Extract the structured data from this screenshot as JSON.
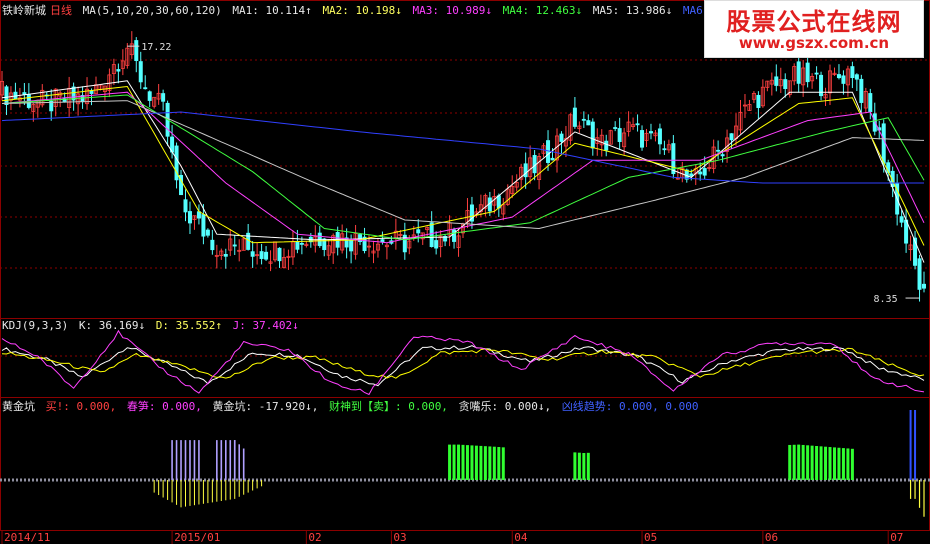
{
  "header": {
    "stock_name": "铁岭新城",
    "period": "日线",
    "ma_params": "MA(5,10,20,30,60,120)",
    "ma1": "MA1: 10.114↑",
    "ma2": "MA2: 10.198↓",
    "ma3": "MA3: 10.989↓",
    "ma4": "MA4: 12.463↓",
    "ma5": "MA5: 13.986↓",
    "ma6": "MA6: 14.551↓"
  },
  "kdj_header": {
    "name": "KDJ(9,3,3)",
    "k": "K: 36.169↓",
    "d": "D: 35.552↑",
    "j": "J: 37.402↓"
  },
  "gold_header": {
    "name": "黄金坑",
    "buy": "买!: 0.000,",
    "spring": "春笋: 0.000,",
    "gold": "黄金坑: -17.920↓,",
    "sell": "财神到【卖】: 0.000,",
    "greedy": "贪嘴乐: 0.000↓,",
    "trend": "凶线趋势: 0.000, 0.000"
  },
  "watermark": {
    "title": "股票公式在线网",
    "url": "www.gszx.com.cn"
  },
  "colors": {
    "up": "#ff4040",
    "down": "#54ffff",
    "ma1": "#ffffff",
    "ma2": "#ffff00",
    "ma3": "#ff40ff",
    "ma4": "#40ff40",
    "ma5": "#c8c8c8",
    "ma6": "#3040ff",
    "grid": "#8b0000",
    "buy_bar": "#ffff40",
    "spring": "#b0a0ff",
    "sell": "#30ff30",
    "trend": "#3050ff"
  },
  "chart_data": [
    {
      "type": "candlestick",
      "title": "铁岭新城 日线",
      "ylim": [
        8.0,
        18.0
      ],
      "annotations": [
        {
          "label": "17.22",
          "x_index": 28
        },
        {
          "label": "8.35",
          "x_index": 205
        }
      ],
      "x_ticks": [
        "2014/11",
        "2015/01",
        "02",
        "03",
        "04",
        "05",
        "06",
        "07"
      ],
      "price_points": [
        [
          0,
          15.6
        ],
        [
          10,
          15.2
        ],
        [
          20,
          15.5
        ],
        [
          28,
          17.22
        ],
        [
          32,
          15.8
        ],
        [
          36,
          14.9
        ],
        [
          40,
          11.6
        ],
        [
          48,
          10.2
        ],
        [
          60,
          10.0
        ],
        [
          70,
          10.5
        ],
        [
          80,
          10.4
        ],
        [
          90,
          10.3
        ],
        [
          100,
          10.6
        ],
        [
          110,
          11.8
        ],
        [
          120,
          13.1
        ],
        [
          128,
          14.6
        ],
        [
          134,
          13.8
        ],
        [
          140,
          14.3
        ],
        [
          148,
          13.6
        ],
        [
          154,
          12.3
        ],
        [
          160,
          13.5
        ],
        [
          168,
          15.4
        ],
        [
          176,
          16.1
        ],
        [
          184,
          15.9
        ],
        [
          190,
          16.4
        ],
        [
          196,
          14.0
        ],
        [
          202,
          10.4
        ],
        [
          206,
          8.35
        ]
      ],
      "series": [
        {
          "name": "MA1",
          "points": [
            [
              0,
              15.4
            ],
            [
              28,
              16.0
            ],
            [
              40,
              13.0
            ],
            [
              48,
              10.6
            ],
            [
              70,
              10.4
            ],
            [
              100,
              10.5
            ],
            [
              128,
              14.2
            ],
            [
              154,
              12.6
            ],
            [
              176,
              15.6
            ],
            [
              190,
              15.6
            ],
            [
              206,
              9.6
            ]
          ]
        },
        {
          "name": "MA2",
          "points": [
            [
              0,
              15.3
            ],
            [
              28,
              15.8
            ],
            [
              44,
              11.4
            ],
            [
              56,
              10.3
            ],
            [
              80,
              10.4
            ],
            [
              110,
              11.4
            ],
            [
              128,
              13.8
            ],
            [
              154,
              12.8
            ],
            [
              178,
              15.2
            ],
            [
              190,
              15.4
            ],
            [
              206,
              10.2
            ]
          ]
        },
        {
          "name": "MA3",
          "points": [
            [
              0,
              15.2
            ],
            [
              28,
              15.6
            ],
            [
              50,
              12.4
            ],
            [
              66,
              10.6
            ],
            [
              86,
              10.3
            ],
            [
              114,
              11.2
            ],
            [
              132,
              13.2
            ],
            [
              156,
              13.2
            ],
            [
              180,
              14.6
            ],
            [
              194,
              14.9
            ],
            [
              206,
              11.0
            ]
          ]
        },
        {
          "name": "MA4",
          "points": [
            [
              0,
              15.2
            ],
            [
              28,
              15.5
            ],
            [
              56,
              12.8
            ],
            [
              72,
              10.8
            ],
            [
              90,
              10.4
            ],
            [
              118,
              11.0
            ],
            [
              140,
              12.6
            ],
            [
              160,
              13.2
            ],
            [
              184,
              14.2
            ],
            [
              198,
              14.7
            ],
            [
              206,
              12.5
            ]
          ]
        },
        {
          "name": "MA5",
          "points": [
            [
              0,
              15.2
            ],
            [
              28,
              15.3
            ],
            [
              70,
              12.4
            ],
            [
              90,
              11.1
            ],
            [
              120,
              10.8
            ],
            [
              146,
              11.8
            ],
            [
              166,
              12.6
            ],
            [
              190,
              14.0
            ],
            [
              206,
              13.9
            ]
          ]
        },
        {
          "name": "MA6",
          "points": [
            [
              0,
              14.6
            ],
            [
              40,
              14.9
            ],
            [
              80,
              14.2
            ],
            [
              120,
              13.6
            ],
            [
              150,
              12.6
            ],
            [
              170,
              12.4
            ],
            [
              206,
              12.4
            ]
          ]
        }
      ]
    },
    {
      "type": "line",
      "title": "KDJ(9,3,3)",
      "ylim": [
        0,
        100
      ],
      "series": [
        {
          "name": "K",
          "points": [
            [
              0,
              72
            ],
            [
              10,
              55
            ],
            [
              18,
              28
            ],
            [
              28,
              75
            ],
            [
              38,
              45
            ],
            [
              46,
              20
            ],
            [
              56,
              65
            ],
            [
              66,
              62
            ],
            [
              76,
              30
            ],
            [
              84,
              18
            ],
            [
              94,
              72
            ],
            [
              106,
              74
            ],
            [
              118,
              52
            ],
            [
              130,
              74
            ],
            [
              142,
              60
            ],
            [
              152,
              22
            ],
            [
              162,
              52
            ],
            [
              174,
              70
            ],
            [
              188,
              72
            ],
            [
              196,
              42
            ],
            [
              206,
              25
            ]
          ]
        },
        {
          "name": "D",
          "points": [
            [
              0,
              66
            ],
            [
              12,
              52
            ],
            [
              22,
              35
            ],
            [
              30,
              62
            ],
            [
              40,
              45
            ],
            [
              50,
              26
            ],
            [
              60,
              58
            ],
            [
              70,
              58
            ],
            [
              80,
              36
            ],
            [
              88,
              26
            ],
            [
              98,
              65
            ],
            [
              110,
              70
            ],
            [
              122,
              55
            ],
            [
              134,
              68
            ],
            [
              146,
              58
            ],
            [
              156,
              30
            ],
            [
              166,
              48
            ],
            [
              178,
              66
            ],
            [
              190,
              70
            ],
            [
              198,
              48
            ],
            [
              206,
              30
            ]
          ]
        },
        {
          "name": "J",
          "points": [
            [
              0,
              86
            ],
            [
              8,
              60
            ],
            [
              16,
              12
            ],
            [
              26,
              96
            ],
            [
              36,
              40
            ],
            [
              44,
              5
            ],
            [
              54,
              80
            ],
            [
              64,
              70
            ],
            [
              74,
              18
            ],
            [
              82,
              4
            ],
            [
              92,
              90
            ],
            [
              104,
              82
            ],
            [
              116,
              40
            ],
            [
              128,
              90
            ],
            [
              140,
              64
            ],
            [
              150,
              8
            ],
            [
              160,
              60
            ],
            [
              172,
              80
            ],
            [
              186,
              80
            ],
            [
              194,
              28
            ],
            [
              206,
              6
            ]
          ]
        }
      ]
    },
    {
      "type": "bar",
      "title": "黄金坑",
      "ylim": [
        -40,
        40
      ],
      "series": [
        {
          "name": "黄金坑",
          "points": [
            [
              34,
              -12
            ],
            [
              40,
              -26
            ],
            [
              46,
              -22
            ],
            [
              52,
              -18
            ],
            [
              58,
              -6
            ]
          ]
        },
        {
          "name": "春笋",
          "points": [
            [
              38,
              38
            ],
            [
              44,
              38
            ],
            [
              48,
              38
            ],
            [
              52,
              38
            ],
            [
              54,
              30
            ]
          ]
        },
        {
          "name": "贪嘴乐",
          "points": [
            [
              102,
              28
            ],
            [
              110,
              26
            ],
            [
              130,
              20
            ],
            [
              178,
              28
            ],
            [
              190,
              24
            ]
          ]
        },
        {
          "name": "凶线趋势",
          "points": [
            [
              204,
              70
            ]
          ]
        },
        {
          "name": "黄金坑-end",
          "points": [
            [
              204,
              -18
            ],
            [
              206,
              -35
            ]
          ]
        }
      ]
    }
  ]
}
